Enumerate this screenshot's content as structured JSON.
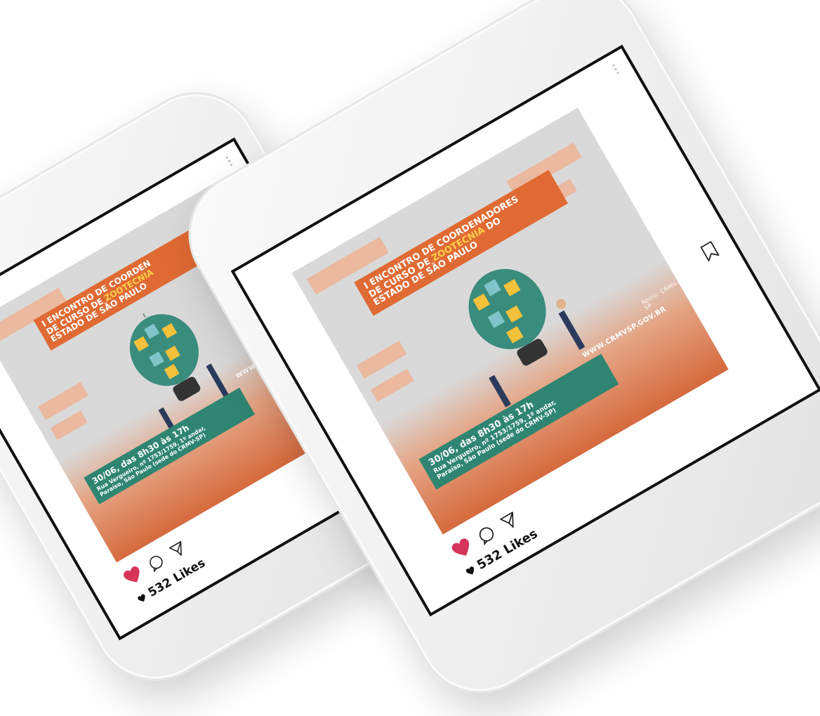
{
  "post": {
    "title_line1": "I ENCONTRO DE COORDENADORES",
    "title_line2_prefix": "DE CURSO DE ",
    "title_line2_accent": "ZOOTECNIA",
    "title_line2_suffix": " DO",
    "title_line3": "ESTADO DE SÃO PAULO",
    "title_line1_cropped": "I ENCONTRO DE COORDEN",
    "date_text": "30/06, das 8h30 às 17h",
    "address_line1": "Rua Vergueiro, nº 1753/1759, 1º andar,",
    "address_line2": "Paraíso, São Paulo (sede do CRMV-SP)",
    "website": "WWW.CRMVSP.GOV.BR",
    "website_cropped": "WWW.CRMVSP.",
    "org_label": "Apoio:",
    "org_name": "CRMV-SP"
  },
  "likes": {
    "count_text": "532 Likes"
  },
  "icons": {
    "like": "heart-icon",
    "comment": "comment-icon",
    "share": "send-icon",
    "save": "bookmark-icon",
    "menu": "more-dots-icon"
  },
  "colors": {
    "heart": "#d6345a",
    "banner_orange": "#e06a33",
    "banner_accent": "#ffd04a",
    "event_green": "#2f8571",
    "stripe_peach": "#ebb9a0"
  }
}
